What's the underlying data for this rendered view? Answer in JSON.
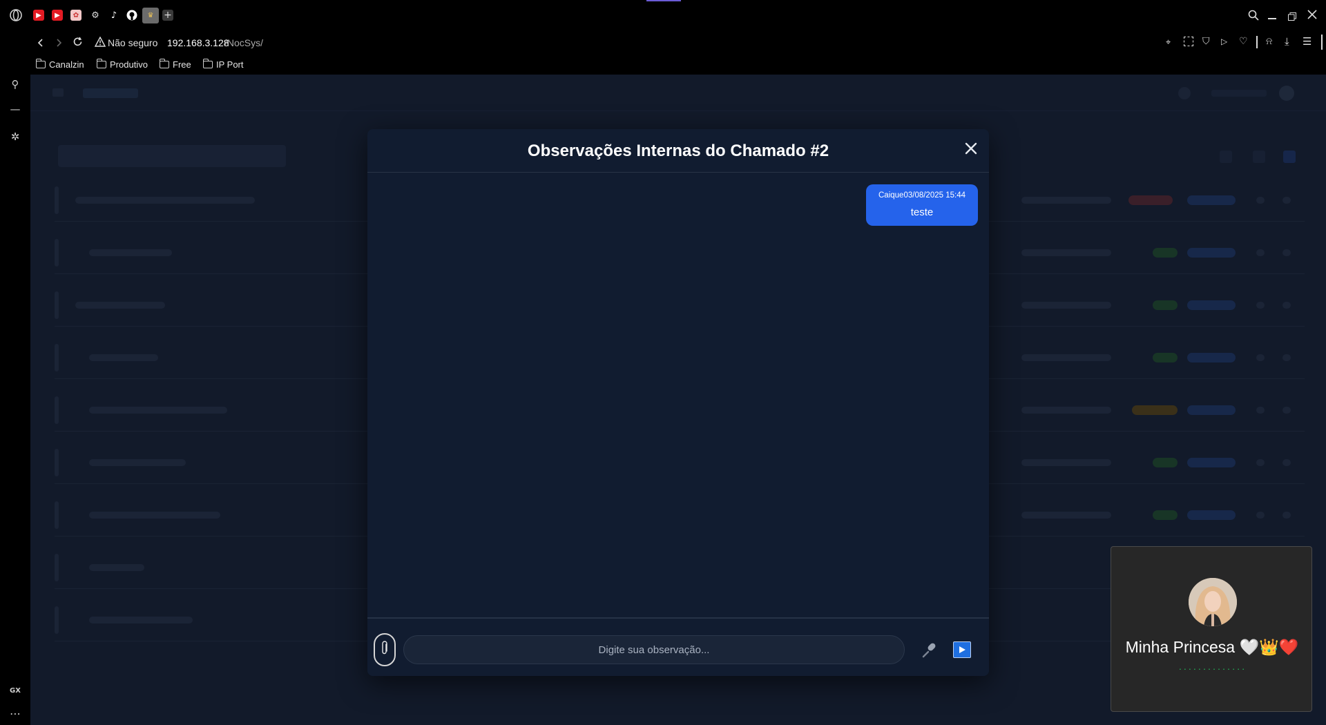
{
  "browser": {
    "address": {
      "security_label": "Não seguro",
      "url_host": "192.168.3.128",
      "url_path": "/NocSys/"
    },
    "bookmarks": [
      "Canalzin",
      "Produtivo",
      "Free",
      "IP Port"
    ],
    "sidebar_bottom_label": "GX"
  },
  "modal": {
    "title": "Observações Internas do Chamado #2",
    "messages": [
      {
        "author": "Caique",
        "timestamp": "03/08/2025 15:44",
        "text": "teste"
      }
    ],
    "input_placeholder": "Digite sua observação...",
    "accent_color": "#2563eb"
  },
  "call_widget": {
    "name": "Minha Princesa 🤍👑❤️",
    "status_dots": "..............",
    "status_color": "#22c55e"
  }
}
